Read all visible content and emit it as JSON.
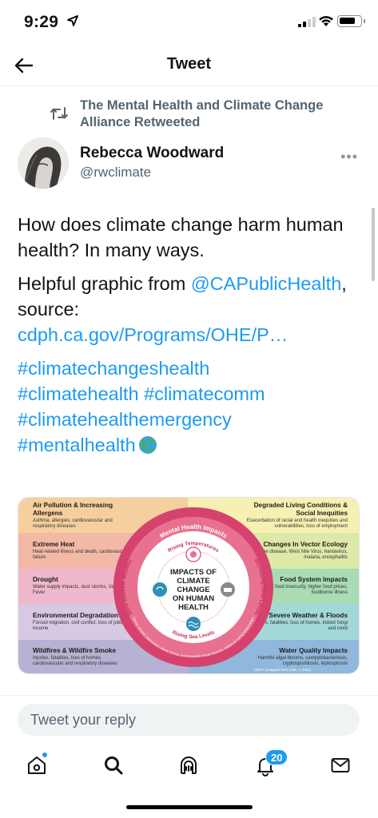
{
  "status_bar": {
    "time": "9:29"
  },
  "nav": {
    "title": "Tweet"
  },
  "retweet": {
    "text": "The Mental Health and Climate Change Alliance Retweeted"
  },
  "author": {
    "name": "Rebecca Woodward",
    "handle": "@rwclimate",
    "more": "•••"
  },
  "tweet": {
    "line1": "How does climate change harm human health? In many ways.",
    "line2_prefix": "Helpful graphic from ",
    "mention": "@CAPublicHealth",
    "line2_suffix": ", source:",
    "url": "cdph.ca.gov/Programs/OHE/P…",
    "hashtags": [
      "#climatechangeshealth",
      "#climatehealth",
      "#climatecomm",
      "#climatehealthemergency",
      "#mentalhealth"
    ]
  },
  "graphic": {
    "center_title": [
      "IMPACTS OF",
      "CLIMATE",
      "CHANGE",
      "ON HUMAN",
      "HEALTH"
    ],
    "ring_labels": {
      "top": "Mental Health Impacts",
      "inner_top": "Rising Temperatures",
      "left": "More Extreme Weather",
      "right": "Increasing GHG Levels",
      "bottom": "Rising Sea Levels",
      "outer_bottom": "Stress, anxiety, depression, sense of loss, post-traumatic stress disorder, strains on social relationships"
    },
    "credit": "CDPH (Adapted from CDC, J. Patz)",
    "left_panels": [
      {
        "title": "Air Pollution & Increasing Allergens",
        "desc": "Asthma, allergies, cardiovascular and respiratory diseases",
        "color": "#f6cf9e"
      },
      {
        "title": "Extreme Heat",
        "desc": "Heat-related illness and death, cardiovascular failure",
        "color": "#f2b9a6"
      },
      {
        "title": "Drought",
        "desc": "Water supply impacts, dust storms, Valley Fever",
        "color": "#efb8cc"
      },
      {
        "title": "Environmental Degradation",
        "desc": "Forced migration, civil conflict, loss of jobs and income",
        "color": "#d7c9e3"
      },
      {
        "title": "Wildfires & Wildfire Smoke",
        "desc": "Injuries, fatalities, loss of homes, cardiovascular and respiratory diseases",
        "color": "#b6b2d4"
      }
    ],
    "right_panels": [
      {
        "title": "Degraded Living Conditions & Social Inequities",
        "desc": "Exacerbation of racial and health inequities and vulnerabilities, loss of employment",
        "color": "#f6f0b2"
      },
      {
        "title": "Changes In Vector Ecology",
        "desc": "Lyme disease, West Nile Virus, hantavirus, malaria, encephalitis",
        "color": "#dde9a8"
      },
      {
        "title": "Food System Impacts",
        "desc": "Malnutrition, food insecurity, higher food prices, foodborne illness",
        "color": "#a9dcb5"
      },
      {
        "title": "Severe Weather & Floods",
        "desc": "Injuries, fatalities, loss of homes, indoor fungi and mold",
        "color": "#a3d8d8"
      },
      {
        "title": "Water Quality Impacts",
        "desc": "Harmful algal blooms, campylobacteriosis, cryptosporidiosis, leptospirosis",
        "color": "#8fb8dc"
      }
    ]
  },
  "reply": {
    "placeholder": "Tweet your reply"
  },
  "tabbar": {
    "notifications_count": "20"
  }
}
